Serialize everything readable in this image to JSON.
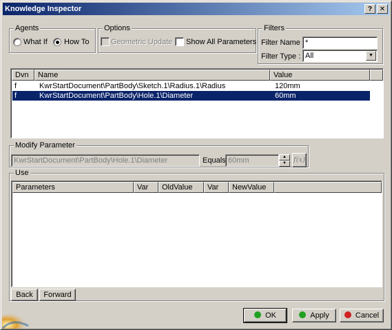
{
  "window": {
    "title": "Knowledge Inspector",
    "help_label": "?",
    "close_label": "✕"
  },
  "agents": {
    "label": "Agents",
    "what_if_label": "What If",
    "how_to_label": "How To",
    "selected": "How To"
  },
  "options": {
    "label": "Options",
    "geometric_update_label": "Geometric Update",
    "show_all_parameters_label": "Show All Parameters"
  },
  "filters": {
    "label": "Filters",
    "filter_name_label": "Filter Name :",
    "filter_name_value": "*",
    "filter_type_label": "Filter Type :",
    "filter_type_value": "All"
  },
  "parameters_list": {
    "columns": [
      "Dvn",
      "Name",
      "Value"
    ],
    "rows": [
      {
        "dvn": "f",
        "name": "KwrStartDocument\\PartBody\\Sketch.1\\Radius.1\\Radius",
        "value": "120mm",
        "selected": false
      },
      {
        "dvn": "f",
        "name": "KwrStartDocument\\PartBody\\Hole.1\\Diameter",
        "value": "60mm",
        "selected": true
      }
    ]
  },
  "modify_parameter": {
    "label": "Modify Parameter",
    "path_value": "KwrStartDocument\\PartBody\\Hole.1\\Diameter",
    "equals_label": "Equals",
    "equals_value": "60mm",
    "formula_icon": "f(x)"
  },
  "use": {
    "label": "Use",
    "columns": [
      "Parameters",
      "Var",
      "OldValue",
      "Var",
      "NewValue"
    ]
  },
  "nav": {
    "back_label": "Back",
    "forward_label": "Forward"
  },
  "actions": {
    "ok_label": "OK",
    "apply_label": "Apply",
    "cancel_label": "Cancel",
    "ok_color": "#20a020",
    "apply_color": "#20a020",
    "cancel_color": "#d02020"
  },
  "colors": {
    "title_start": "#0a246a",
    "title_end": "#a6caf0",
    "selection": "#0a246a",
    "face": "#d4d0c8"
  }
}
